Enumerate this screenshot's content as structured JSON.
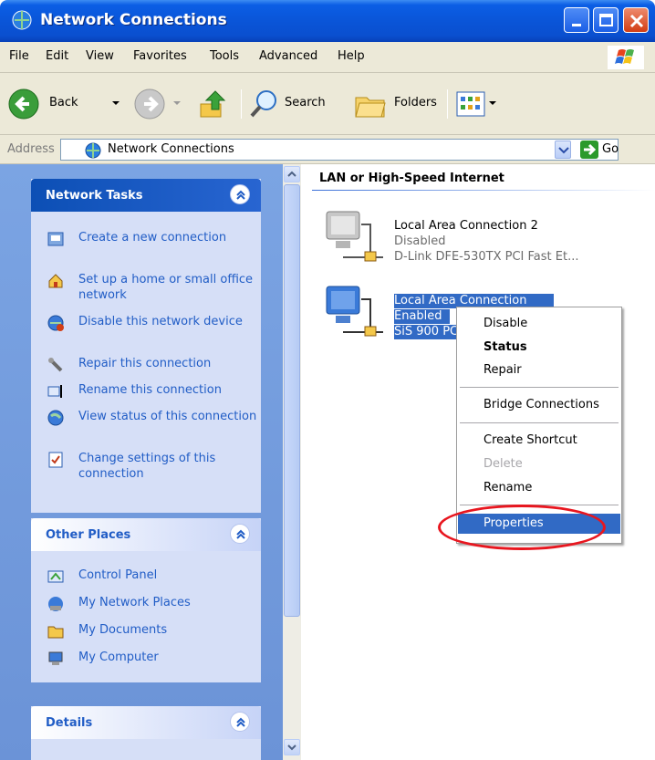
{
  "window": {
    "title": "Network Connections",
    "icon": "network-connections-icon"
  },
  "menubar": [
    "File",
    "Edit",
    "View",
    "Favorites",
    "Tools",
    "Advanced",
    "Help"
  ],
  "toolbar": {
    "back_label": "Back",
    "search_label": "Search",
    "folders_label": "Folders"
  },
  "address": {
    "label": "Address",
    "value": "Network Connections",
    "go_label": "Go"
  },
  "tasks": {
    "network_tasks": {
      "title": "Network Tasks",
      "items": [
        {
          "icon": "create-connection-icon",
          "label": "Create a new connection"
        },
        {
          "icon": "home-network-icon",
          "label": "Set up a home or small office network"
        },
        {
          "icon": "disable-network-icon",
          "label": "Disable this network device"
        },
        {
          "icon": "repair-wrench-icon",
          "label": "Repair this connection"
        },
        {
          "icon": "rename-icon",
          "label": "Rename this connection"
        },
        {
          "icon": "view-status-icon",
          "label": "View status of this connection"
        },
        {
          "icon": "change-settings-icon",
          "label": "Change settings of this connection"
        }
      ]
    },
    "other_places": {
      "title": "Other Places",
      "items": [
        {
          "icon": "control-panel-icon",
          "label": "Control Panel"
        },
        {
          "icon": "my-network-places-icon",
          "label": "My Network Places"
        },
        {
          "icon": "my-documents-icon",
          "label": "My Documents"
        },
        {
          "icon": "my-computer-icon",
          "label": "My Computer"
        }
      ]
    },
    "details": {
      "title": "Details"
    }
  },
  "content": {
    "group_title": "LAN or High-Speed Internet",
    "connections": [
      {
        "name": "Local Area Connection 2",
        "status": "Disabled",
        "device": "D-Link DFE-530TX PCI Fast Et..."
      },
      {
        "name": "Local Area Connection",
        "status": "Enabled",
        "device": "SiS 900 PC"
      }
    ]
  },
  "context_menu": {
    "items": [
      {
        "label": "Disable"
      },
      {
        "label": "Status",
        "bold": true
      },
      {
        "label": "Repair"
      },
      {
        "label": "Bridge Connections"
      },
      {
        "label": "Create Shortcut"
      },
      {
        "label": "Delete",
        "disabled": true
      },
      {
        "label": "Rename"
      },
      {
        "label": "Properties",
        "highlighted": true
      }
    ]
  },
  "colors": {
    "titlebar": "#0a55d8",
    "selection": "#316ac5",
    "task_link": "#215dc6",
    "annotation": "#e8161f"
  }
}
